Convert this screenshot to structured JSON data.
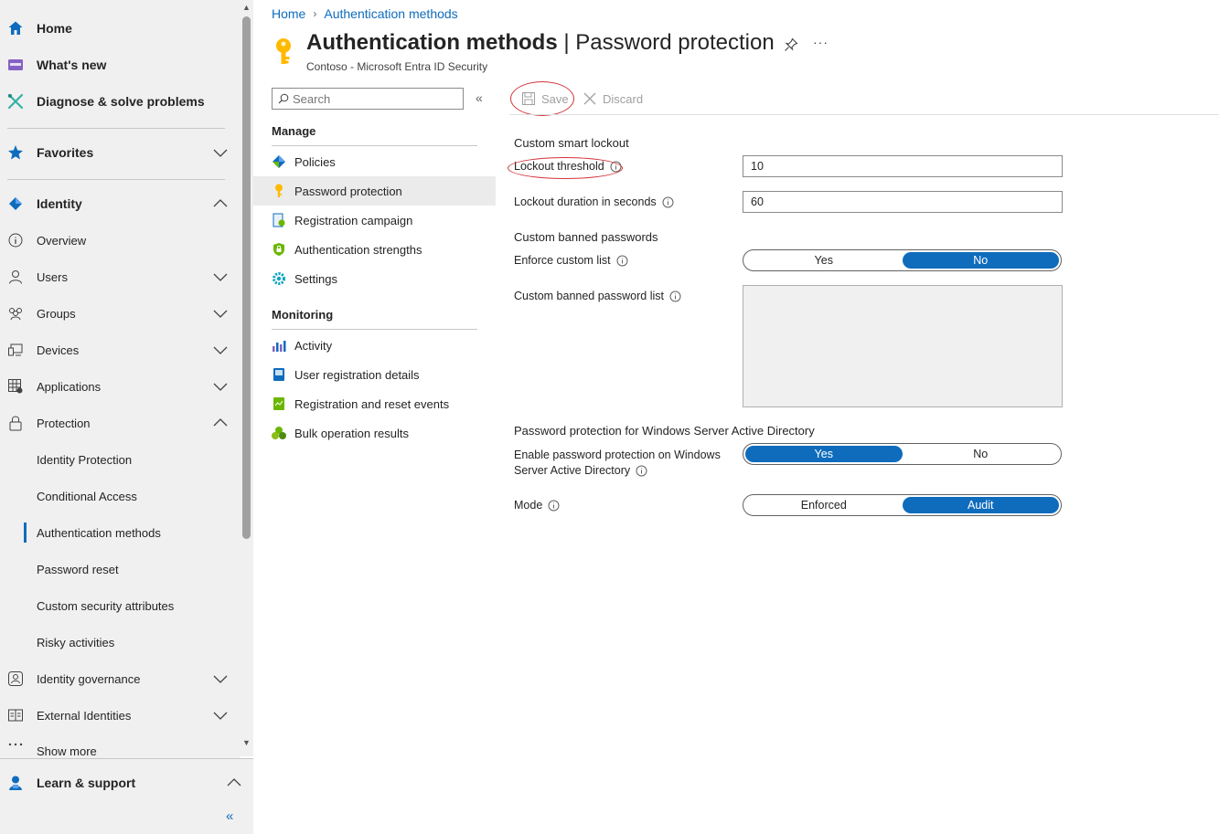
{
  "nav": {
    "home": "Home",
    "whats_new": "What's new",
    "diagnose": "Diagnose & solve problems",
    "favorites": "Favorites",
    "identity": "Identity",
    "overview": "Overview",
    "users": "Users",
    "groups": "Groups",
    "devices": "Devices",
    "applications": "Applications",
    "protection": "Protection",
    "identity_protection": "Identity Protection",
    "conditional_access": "Conditional Access",
    "authentication_methods": "Authentication methods",
    "password_reset": "Password reset",
    "custom_security_attributes": "Custom security attributes",
    "risky_activities": "Risky activities",
    "identity_governance": "Identity governance",
    "external_identities": "External Identities",
    "show_more": "Show more",
    "learn_support": "Learn & support",
    "collapse": "«"
  },
  "breadcrumb": {
    "home": "Home",
    "current": "Authentication methods"
  },
  "header": {
    "title_main": "Authentication methods",
    "title_sep": " | ",
    "title_sub": "Password protection",
    "subtitle": "Contoso - Microsoft Entra ID Security",
    "more": "···"
  },
  "menu": {
    "search_placeholder": "Search",
    "collapse": "«",
    "manage_head": "Manage",
    "policies": "Policies",
    "password_protection": "Password protection",
    "registration_campaign": "Registration campaign",
    "authentication_strengths": "Authentication strengths",
    "settings": "Settings",
    "monitoring_head": "Monitoring",
    "activity": "Activity",
    "user_registration_details": "User registration details",
    "registration_reset_events": "Registration and reset events",
    "bulk_operation_results": "Bulk operation results"
  },
  "toolbar": {
    "save": "Save",
    "discard": "Discard"
  },
  "form": {
    "smart_lockout_head": "Custom smart lockout",
    "lockout_threshold_label": "Lockout threshold",
    "lockout_threshold_value": "10",
    "lockout_duration_label": "Lockout duration in seconds",
    "lockout_duration_value": "60",
    "banned_head": "Custom banned passwords",
    "enforce_custom_label": "Enforce custom list",
    "enforce_yes": "Yes",
    "enforce_no": "No",
    "enforce_selected": "No",
    "banned_list_label": "Custom banned password list",
    "banned_list_value": "",
    "windows_head": "Password protection for Windows Server Active Directory",
    "enable_label_1": "Enable password protection on Windows",
    "enable_label_2": "Server Active Directory",
    "enable_yes": "Yes",
    "enable_no": "No",
    "enable_selected": "Yes",
    "mode_label": "Mode",
    "mode_enforced": "Enforced",
    "mode_audit": "Audit",
    "mode_selected": "Audit"
  },
  "colors": {
    "accent": "#0f6cbd",
    "annotation": "#d13438",
    "nav_bg": "#f0f0f0"
  }
}
